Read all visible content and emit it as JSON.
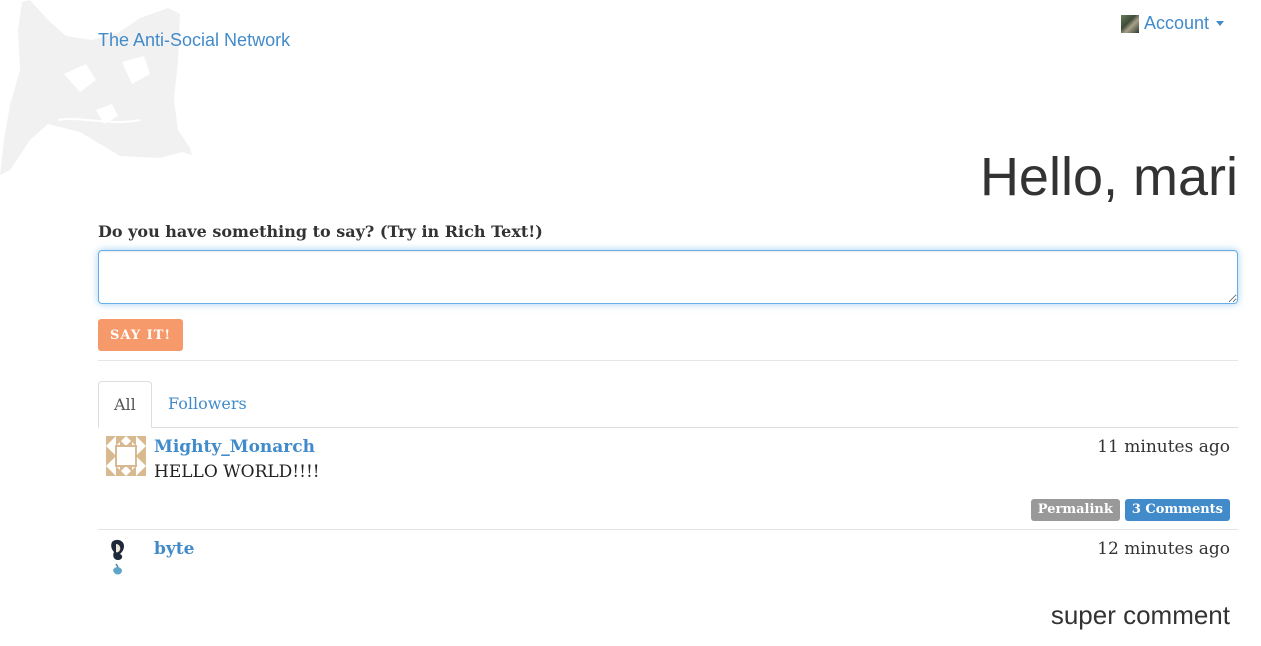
{
  "navbar": {
    "brand": "The Anti-Social Network",
    "account_label": "Account"
  },
  "greeting": "Hello, mari",
  "composer": {
    "prompt": "Do you have something to say? (Try in Rich Text!)",
    "value": "",
    "submit_label": "SAY IT!"
  },
  "tabs": [
    {
      "label": "All",
      "active": true
    },
    {
      "label": "Followers",
      "active": false
    }
  ],
  "feed": [
    {
      "author": "Mighty_Monarch",
      "time": "11 minutes ago",
      "body": "HELLO WORLD!!!!",
      "permalink_label": "Permalink",
      "comments_label": "3 Comments"
    },
    {
      "author": "byte",
      "time": "12 minutes ago",
      "body": "super comment"
    }
  ],
  "colors": {
    "link": "#428bca",
    "submit_button": "#f79a6b",
    "permalink_badge": "#999999",
    "comments_badge": "#428bca",
    "input_focus_border": "#66afe9"
  },
  "icons": {
    "background": "cat-silhouette",
    "account": "user-avatar-thumbnail",
    "dropdown": "caret-down",
    "author_1": "identicon-avatar",
    "author_2": "portrait-avatar"
  }
}
